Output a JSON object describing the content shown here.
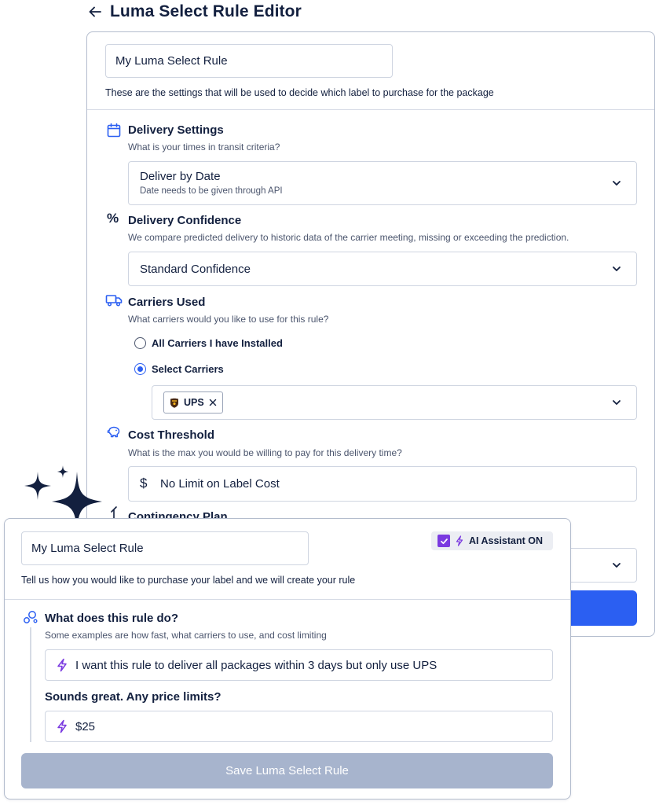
{
  "header": {
    "title": "Luma Select Rule Editor"
  },
  "editor": {
    "rule_name": "My Luma Select Rule",
    "description": "These are the settings that will be used to decide which label to purchase for the package",
    "delivery_settings": {
      "title": "Delivery Settings",
      "subtitle": "What is your times in transit criteria?",
      "selected": "Deliver by Date",
      "selected_sub": "Date needs to be given through API"
    },
    "delivery_confidence": {
      "title": "Delivery Confidence",
      "subtitle": "We compare predicted delivery to historic data of the carrier meeting, missing or exceeding the prediction.",
      "selected": "Standard Confidence"
    },
    "carriers_used": {
      "title": "Carriers Used",
      "subtitle": "What carriers would you like to use for this rule?",
      "options": [
        "All Carriers I have Installed",
        "Select Carriers"
      ],
      "selected_index": 1,
      "chips": [
        "UPS"
      ]
    },
    "cost_threshold": {
      "title": "Cost Threshold",
      "subtitle": "What is the max you would be willing to pay for this delivery time?",
      "value": "No Limit on Label Cost"
    },
    "contingency": {
      "title": "Contingency Plan"
    }
  },
  "assistant": {
    "rule_name": "My Luma Select Rule",
    "toggle_label": "AI Assistant ON",
    "toggle_checked": true,
    "description": "Tell us how you would like to purchase your label and we will create your rule",
    "question1": {
      "title": "What does this rule do?",
      "subtitle": "Some examples are how fast, what carriers to use, and cost limiting",
      "answer": "I want this rule to deliver all packages within 3 days but only use UPS"
    },
    "question2": {
      "title": "Sounds great. Any price limits?",
      "answer": "$25"
    },
    "save_label": "Save Luma Select Rule"
  },
  "colors": {
    "navy": "#13203f",
    "primary_blue": "#2b5ff2",
    "ai_purple": "#7a3ae0",
    "disabled_button": "#a7b4cd"
  }
}
